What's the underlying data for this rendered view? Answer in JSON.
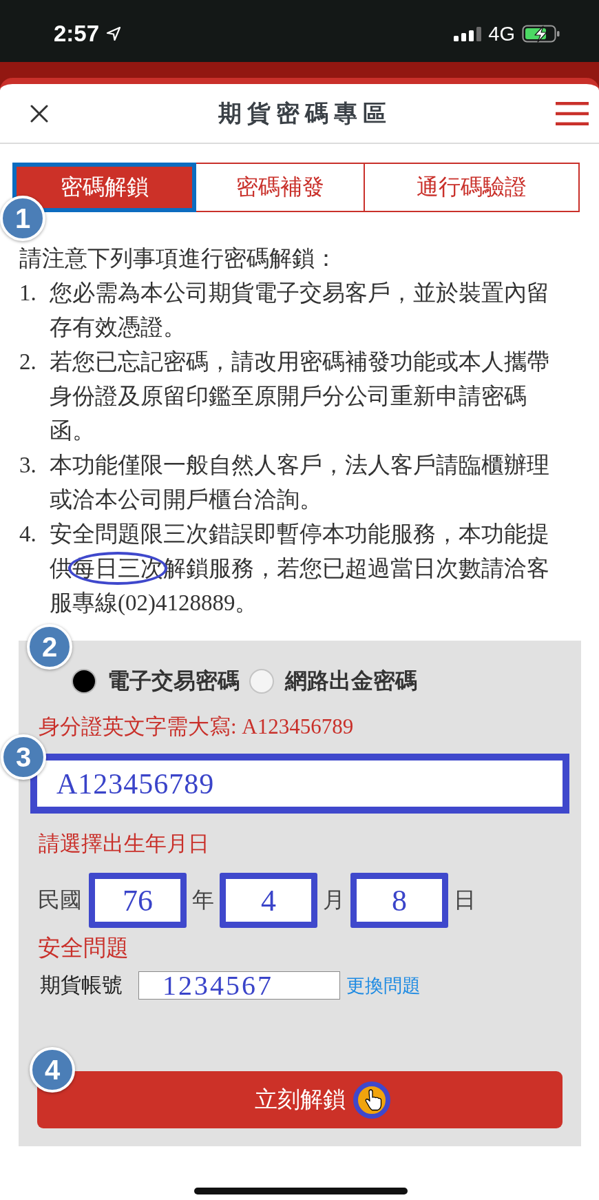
{
  "status_bar": {
    "time": "2:57",
    "network": "4G"
  },
  "header": {
    "title": "期貨密碼專區"
  },
  "tab_bar": {
    "marker": "1",
    "tabs": [
      {
        "label": "密碼解鎖",
        "selected": true,
        "highlighted": true
      },
      {
        "label": "密碼補發",
        "selected": false,
        "highlighted": false
      },
      {
        "label": "通行碼驗證",
        "selected": false,
        "highlighted": false
      }
    ]
  },
  "notice": {
    "heading": "請注意下列事項進行密碼解鎖：",
    "items": [
      {
        "number": "1.",
        "segments": [
          {
            "text": "您必需為本公司期貨電子交易客戶，並於裝置內留存有效憑證。",
            "circled": false
          }
        ]
      },
      {
        "number": "2.",
        "segments": [
          {
            "text": "若您已忘記密碼，請改用密碼補發功能或本人攜帶身份證及原留印鑑至原開戶分公司重新申請密碼函。",
            "circled": false
          }
        ]
      },
      {
        "number": "3.",
        "segments": [
          {
            "text": "本功能僅限一般自然人客戶，法人客戶請臨櫃辦理或洽本公司開戶櫃台洽詢。",
            "circled": false
          }
        ]
      },
      {
        "number": "4.",
        "segments": [
          {
            "text": "安全問題限三次錯誤即暫停本功能服務，本功能提供",
            "circled": false
          },
          {
            "text": "每日三次",
            "circled": true
          },
          {
            "text": "解鎖服務，若您已超過當日次數請洽客服專線(02)4128889。",
            "circled": false
          }
        ]
      }
    ]
  },
  "form": {
    "radio_group": {
      "marker": "2",
      "options": [
        {
          "label": "電子交易密碼",
          "selected": true
        },
        {
          "label": "網路出金密碼",
          "selected": false
        }
      ]
    },
    "id_hint": "身分證英文字需大寫: A123456789",
    "id_field": {
      "marker": "3",
      "value": "A123456789",
      "highlighted": true
    },
    "birth_label": "請選擇出生年月日",
    "birth_date": {
      "prefix": "民國",
      "parts": [
        {
          "value": "76",
          "unit": "年",
          "highlighted": true
        },
        {
          "value": "4",
          "unit": "月",
          "highlighted": true
        },
        {
          "value": "8",
          "unit": "日",
          "highlighted": true
        }
      ]
    },
    "security_heading": "安全問題",
    "security_question": {
      "label": "期貨帳號",
      "value": "1234567",
      "highlighted": false,
      "link": "更換問題"
    },
    "submit_button": {
      "marker": "4",
      "label": "立刻解鎖"
    }
  }
}
